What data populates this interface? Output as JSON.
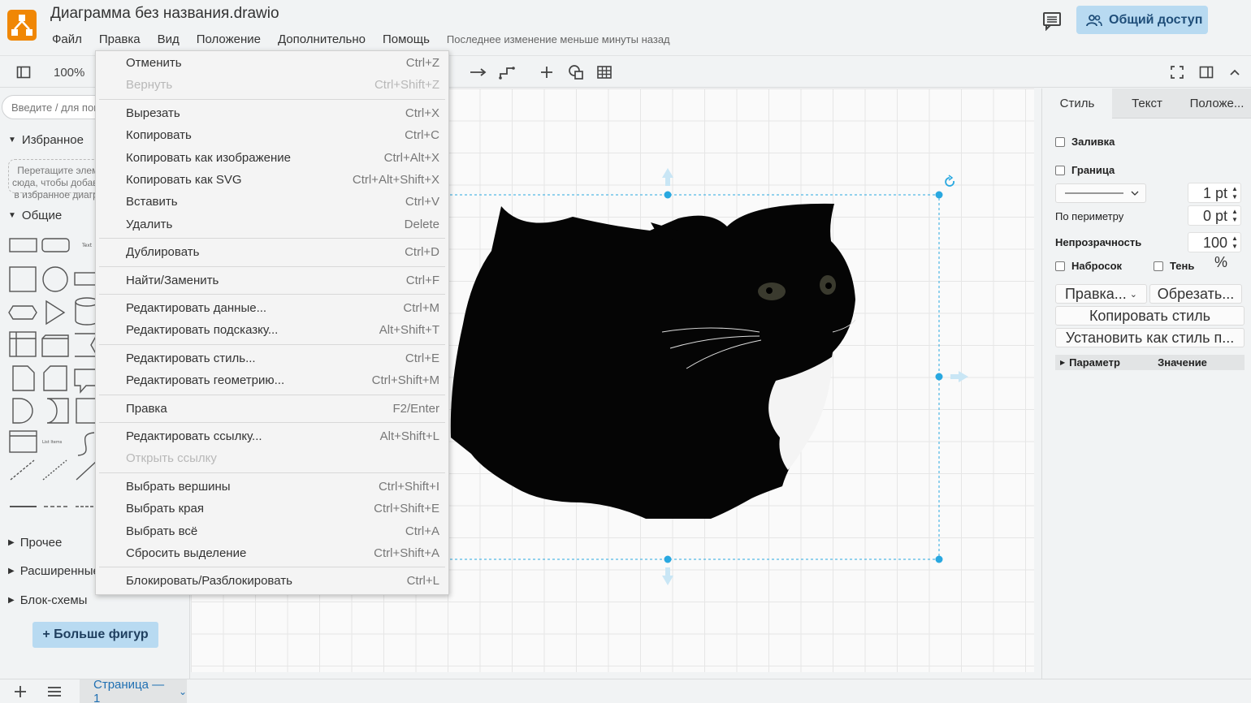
{
  "header": {
    "title": "Диаграмма без названия.drawio",
    "menu": [
      "Файл",
      "Правка",
      "Вид",
      "Положение",
      "Дополнительно",
      "Помощь"
    ],
    "last_change": "Последнее изменение меньше минуты назад",
    "share_label": "Общий доступ",
    "accent": "#f08705",
    "share_bg": "#b8daf1"
  },
  "toolbar": {
    "zoom": "100%"
  },
  "sidebar": {
    "search_placeholder": "Введите / для поиска",
    "favorites_label": "Избранное",
    "fav_drop_text": "Перетащите элементы сюда, чтобы добавить их в избранное диаграммы",
    "general_label": "Общие",
    "sections": [
      "Прочее",
      "Расширенные",
      "Блок-схемы"
    ],
    "more_shapes": "+ Больше фигур"
  },
  "edit_menu": {
    "groups": [
      [
        {
          "label": "Отменить",
          "shortcut": "Ctrl+Z",
          "disabled": false
        },
        {
          "label": "Вернуть",
          "shortcut": "Ctrl+Shift+Z",
          "disabled": true
        }
      ],
      [
        {
          "label": "Вырезать",
          "shortcut": "Ctrl+X",
          "disabled": false
        },
        {
          "label": "Копировать",
          "shortcut": "Ctrl+C",
          "disabled": false
        },
        {
          "label": "Копировать как изображение",
          "shortcut": "Ctrl+Alt+X",
          "disabled": false
        },
        {
          "label": "Копировать как SVG",
          "shortcut": "Ctrl+Alt+Shift+X",
          "disabled": false
        },
        {
          "label": "Вставить",
          "shortcut": "Ctrl+V",
          "disabled": false
        },
        {
          "label": "Удалить",
          "shortcut": "Delete",
          "disabled": false
        }
      ],
      [
        {
          "label": "Дублировать",
          "shortcut": "Ctrl+D",
          "disabled": false
        }
      ],
      [
        {
          "label": "Найти/Заменить",
          "shortcut": "Ctrl+F",
          "disabled": false
        }
      ],
      [
        {
          "label": "Редактировать данные...",
          "shortcut": "Ctrl+M",
          "disabled": false
        },
        {
          "label": "Редактировать подсказку...",
          "shortcut": "Alt+Shift+T",
          "disabled": false
        }
      ],
      [
        {
          "label": "Редактировать стиль...",
          "shortcut": "Ctrl+E",
          "disabled": false
        },
        {
          "label": "Редактировать геометрию...",
          "shortcut": "Ctrl+Shift+M",
          "disabled": false
        }
      ],
      [
        {
          "label": "Правка",
          "shortcut": "F2/Enter",
          "disabled": false
        }
      ],
      [
        {
          "label": "Редактировать ссылку...",
          "shortcut": "Alt+Shift+L",
          "disabled": false
        },
        {
          "label": "Открыть ссылку",
          "shortcut": "",
          "disabled": true
        }
      ],
      [
        {
          "label": "Выбрать вершины",
          "shortcut": "Ctrl+Shift+I",
          "disabled": false
        },
        {
          "label": "Выбрать края",
          "shortcut": "Ctrl+Shift+E",
          "disabled": false
        },
        {
          "label": "Выбрать всё",
          "shortcut": "Ctrl+A",
          "disabled": false
        },
        {
          "label": "Сбросить выделение",
          "shortcut": "Ctrl+Shift+A",
          "disabled": false
        }
      ],
      [
        {
          "label": "Блокировать/Разблокировать",
          "shortcut": "Ctrl+L",
          "disabled": false
        }
      ]
    ]
  },
  "format_panel": {
    "tabs": [
      "Стиль",
      "Текст",
      "Положе..."
    ],
    "fill_label": "Заливка",
    "border_label": "Граница",
    "border_width": "1 pt",
    "perimeter_label": "По периметру",
    "perimeter_value": "0 pt",
    "opacity_label": "Непрозрачность",
    "opacity_value": "100 %",
    "sketch_label": "Набросок",
    "shadow_label": "Тень",
    "edit_btn": "Правка...",
    "crop_btn": "Обрезать...",
    "copy_style_btn": "Копировать стиль",
    "set_default_btn": "Установить как стиль п...",
    "prop_header": "Параметр",
    "value_header": "Значение"
  },
  "bottombar": {
    "page_tab": "Страница — 1"
  }
}
